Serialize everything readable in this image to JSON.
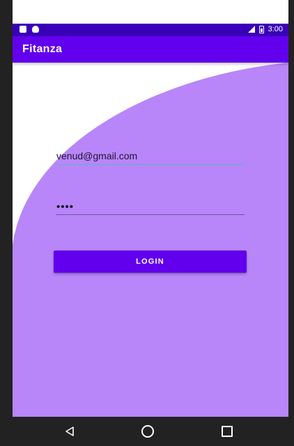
{
  "status_bar": {
    "time": "3:00",
    "left_icons": [
      "sd-card-icon",
      "android-icon"
    ],
    "right_icons": [
      "lte-signal-icon",
      "battery-icon"
    ]
  },
  "app_bar": {
    "title": "Fitanza"
  },
  "login_form": {
    "email_value": "venud@gmail.com",
    "password_value": "••••",
    "login_label": "LOGIN"
  },
  "nav_bar": {
    "buttons": [
      "back-icon",
      "home-icon",
      "recents-icon"
    ]
  },
  "colors": {
    "primary": "#6200ee",
    "primary_dark": "#3a00b8",
    "purple_surface": "#b886f8",
    "nav_background": "#222222"
  }
}
